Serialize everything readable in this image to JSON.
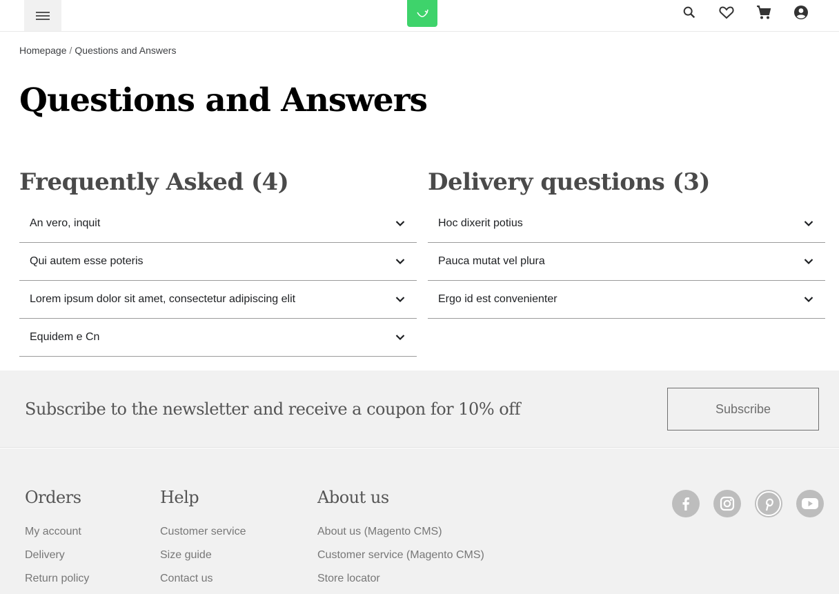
{
  "header": {
    "menu_icon": "hamburger-menu-icon",
    "logo_icon": "shopping-bag-logo-icon",
    "icons": [
      "search-icon",
      "heart-icon",
      "cart-icon",
      "account-icon"
    ]
  },
  "breadcrumb": {
    "home": "Homepage",
    "separator": "/",
    "current": "Questions and Answers"
  },
  "page": {
    "title": "Questions and Answers"
  },
  "faq_columns": [
    {
      "title": "Frequently Asked (4)",
      "questions": [
        "An vero, inquit",
        "Qui autem esse poteris",
        "Lorem ipsum dolor sit amet, consectetur adipiscing elit",
        "Equidem e Cn"
      ]
    },
    {
      "title": "Delivery questions (3)",
      "questions": [
        "Hoc dixerit potius",
        "Pauca mutat vel plura",
        "Ergo id est convenienter"
      ]
    }
  ],
  "newsletter": {
    "text": "Subscribe to the newsletter and receive a coupon for 10% off",
    "button": "Subscribe"
  },
  "footer": {
    "columns": [
      {
        "title": "Orders",
        "links": [
          "My account",
          "Delivery",
          "Return policy"
        ]
      },
      {
        "title": "Help",
        "links": [
          "Customer service",
          "Size guide",
          "Contact us"
        ]
      },
      {
        "title": "About us",
        "links": [
          "About us (Magento CMS)",
          "Customer service (Magento CMS)",
          "Store locator"
        ]
      }
    ],
    "social": [
      "facebook-icon",
      "instagram-icon",
      "pinterest-icon",
      "youtube-icon"
    ]
  },
  "colors": {
    "brand_green": "#3ed36b",
    "footer_bg": "#f1f1f1",
    "social_icon_bg": "#bdbdbd"
  }
}
